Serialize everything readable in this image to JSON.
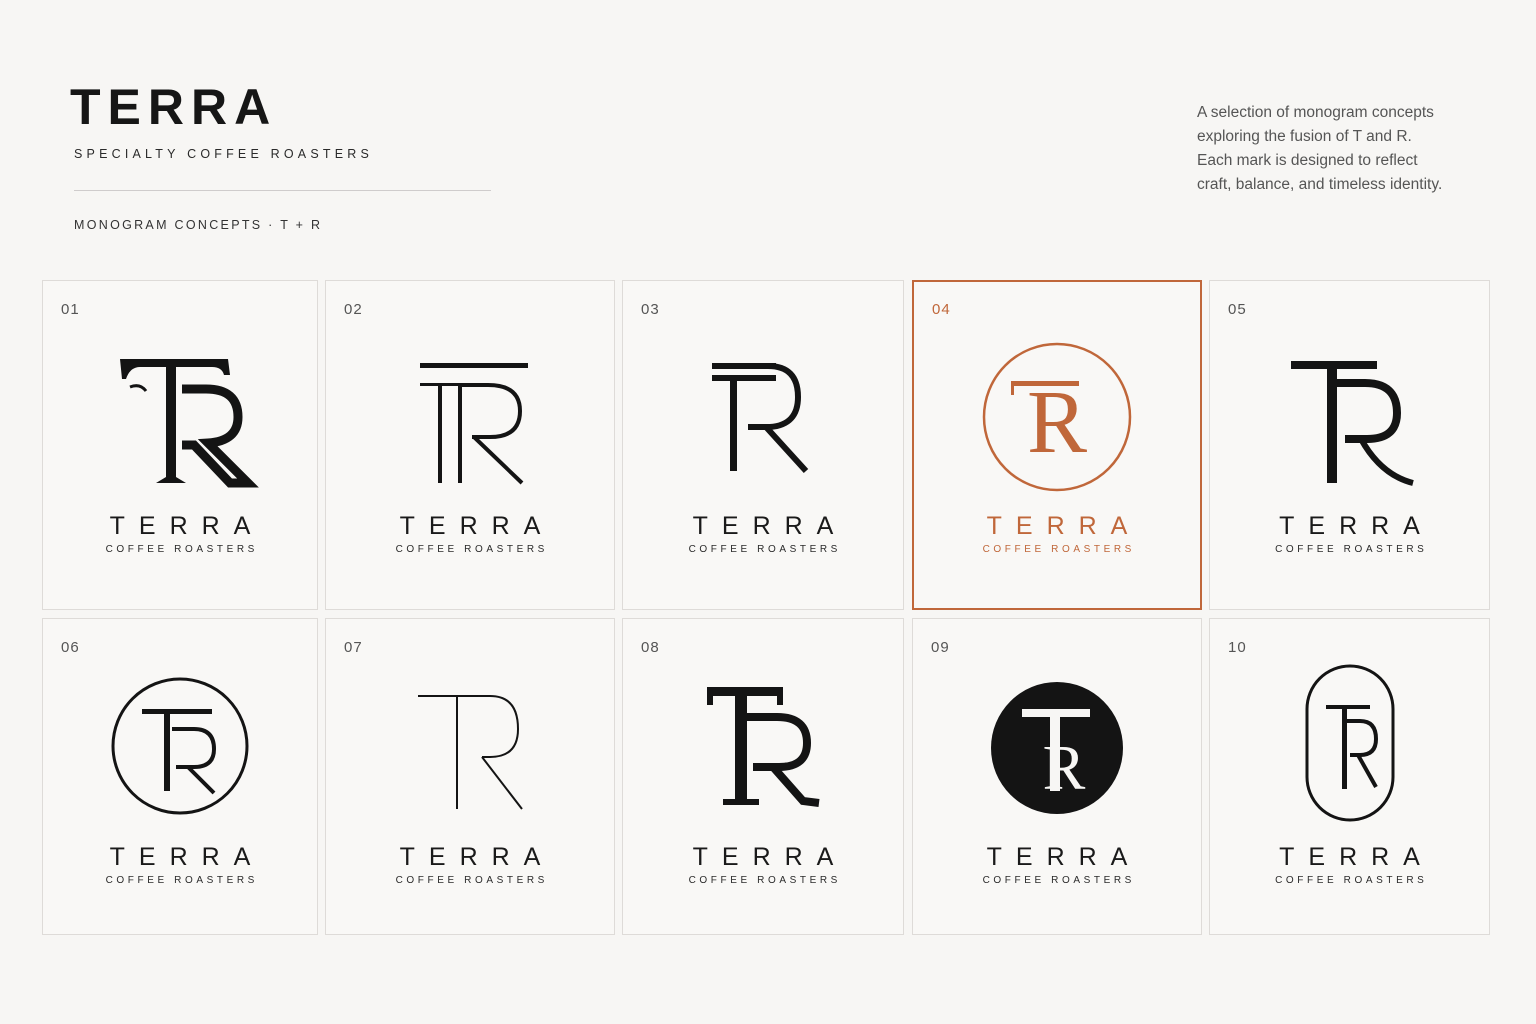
{
  "header": {
    "brand": "TERRA",
    "subtitle": "SPECIALTY COFFEE ROASTERS",
    "section_label": "MONOGRAM CONCEPTS · T + R"
  },
  "intro": {
    "lines": [
      "A selection of monogram concepts",
      "exploring the fusion of T and R.",
      "Each mark is designed to reflect",
      "craft, balance, and timeless identity."
    ]
  },
  "colors": {
    "background": "#f7f6f4",
    "ink": "#1a1a1a",
    "accent": "#c0673a",
    "card_border": "#dedbd8"
  },
  "concepts": [
    {
      "number": "01",
      "wordmark": "TERRA",
      "tagline": "COFFEE ROASTERS",
      "style": "serif-t-over-r"
    },
    {
      "number": "02",
      "wordmark": "TERRA",
      "tagline": "COFFEE ROASTERS",
      "style": "thin-line-tr"
    },
    {
      "number": "03",
      "wordmark": "TERRA",
      "tagline": "COFFEE ROASTERS",
      "style": "double-bar-tr"
    },
    {
      "number": "04",
      "wordmark": "TERRA",
      "tagline": "COFFEE ROASTERS",
      "style": "circle-tr-accent",
      "selected": true
    },
    {
      "number": "05",
      "wordmark": "TERRA",
      "tagline": "COFFEE ROASTERS",
      "style": "serif-t-r-tail"
    },
    {
      "number": "06",
      "wordmark": "TERRA",
      "tagline": "COFFEE ROASTERS",
      "style": "circle-outline-tr"
    },
    {
      "number": "07",
      "wordmark": "TERRA",
      "tagline": "COFFEE ROASTERS",
      "style": "hairline-tr"
    },
    {
      "number": "08",
      "wordmark": "TERRA",
      "tagline": "COFFEE ROASTERS",
      "style": "bold-serif-tr"
    },
    {
      "number": "09",
      "wordmark": "TERRA",
      "tagline": "COFFEE ROASTERS",
      "style": "filled-circle-tr"
    },
    {
      "number": "10",
      "wordmark": "TERRA",
      "tagline": "COFFEE ROASTERS",
      "style": "pill-outline-tr"
    }
  ]
}
